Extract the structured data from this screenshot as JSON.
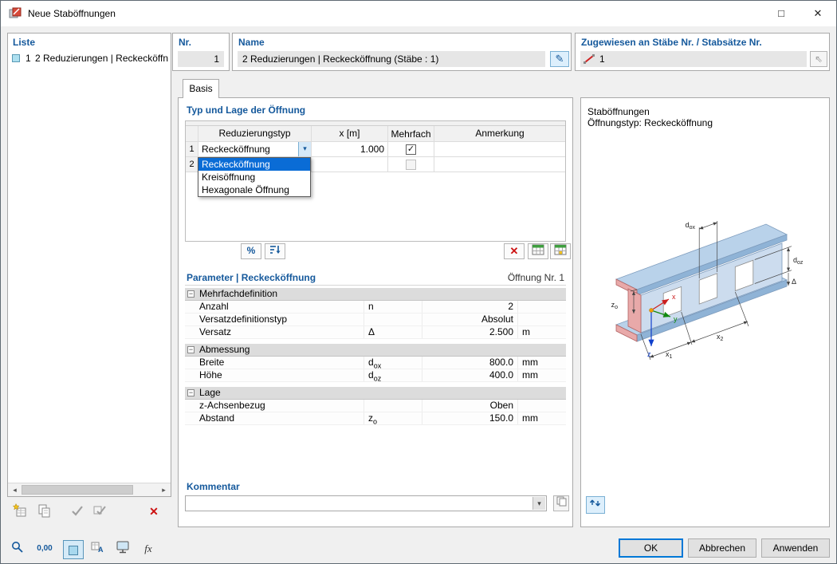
{
  "window": {
    "title": "Neue Staböffnungen"
  },
  "icons": {
    "maximize": "□",
    "close": "✕",
    "check": "✓",
    "dropdown": "▾",
    "pencil": "✎",
    "pick": "⇖",
    "delete": "✕",
    "collapse": "−",
    "scroll_left": "◂",
    "scroll_right": "▸"
  },
  "left_panel": {
    "title": "Liste",
    "item": {
      "num": "1",
      "text": "2 Reduzierungen | Reckecköffn"
    }
  },
  "fields": {
    "nr": {
      "label": "Nr.",
      "value": "1"
    },
    "name": {
      "label": "Name",
      "value": "2 Reduzierungen | Reckecköffnung (Stäbe : 1)"
    },
    "assigned": {
      "label": "Zugewiesen an Stäbe Nr. / Stabsätze Nr.",
      "value": "1"
    }
  },
  "tabs": {
    "basis": "Basis"
  },
  "opening": {
    "title": "Typ und Lage der Öffnung",
    "columns": {
      "type": "Reduzierungstyp",
      "x": "x [m]",
      "multiple": "Mehrfach",
      "note": "Anmerkung"
    },
    "rows": [
      {
        "num": "1",
        "type": "Reckecköffnung",
        "x": "1.000"
      },
      {
        "num": "2",
        "type": "",
        "x": ""
      }
    ],
    "dropdown": [
      "Reckecköffnung",
      "Kreisöffnung",
      "Hexagonale Öffnung"
    ],
    "percent": "%"
  },
  "params": {
    "title": "Parameter | Reckecköffnung",
    "opening_nr": "Öffnung Nr. 1",
    "groups": [
      {
        "name": "Mehrfachdefinition",
        "rows": [
          {
            "label": "Anzahl",
            "sym": "n",
            "sub": "",
            "value": "2",
            "unit": ""
          },
          {
            "label": "Versatzdefinitionstyp",
            "sym": "",
            "sub": "",
            "value": "Absolut",
            "unit": ""
          },
          {
            "label": "Versatz",
            "sym": "Δ",
            "sub": "",
            "value": "2.500",
            "unit": "m"
          }
        ]
      },
      {
        "name": "Abmessung",
        "rows": [
          {
            "label": "Breite",
            "sym": "d",
            "sub": "ox",
            "value": "800.0",
            "unit": "mm"
          },
          {
            "label": "Höhe",
            "sym": "d",
            "sub": "oz",
            "value": "400.0",
            "unit": "mm"
          }
        ]
      },
      {
        "name": "Lage",
        "rows": [
          {
            "label": "z-Achsenbezug",
            "sym": "",
            "sub": "",
            "value": "Oben",
            "unit": ""
          },
          {
            "label": "Abstand",
            "sym": "z",
            "sub": "o",
            "value": "150.0",
            "unit": "mm"
          }
        ]
      }
    ]
  },
  "comment": {
    "label": "Kommentar"
  },
  "preview": {
    "title": "Staböffnungen",
    "subtitle": "Öffnungstyp: Reckecköffnung",
    "labels": {
      "dox": {
        "base": "d",
        "sub": "ox"
      },
      "doz": {
        "base": "d",
        "sub": "oz"
      },
      "zo": {
        "base": "z",
        "sub": "o"
      },
      "delta": "Δ",
      "x1": {
        "base": "x",
        "sub": "1"
      },
      "x2": {
        "base": "x",
        "sub": "2"
      },
      "ax": "x",
      "ay": "y",
      "az": "z"
    }
  },
  "footer": {
    "ok": "OK",
    "cancel": "Abbrechen",
    "apply": "Anwenden"
  },
  "bottom_toolbar": {
    "zeros": "0,00",
    "fx": "fx"
  }
}
